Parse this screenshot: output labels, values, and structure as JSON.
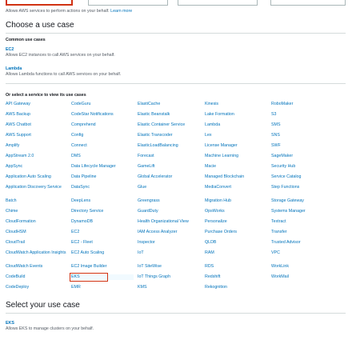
{
  "intro": {
    "text": "Allows AWS services to perform actions on your behalf.",
    "link": "Learn more"
  },
  "choose": {
    "title": "Choose a use case",
    "common_title": "Common use cases",
    "ec2": {
      "name": "EC2",
      "desc": "Allows EC2 instances to call AWS services on your behalf."
    },
    "lambda": {
      "name": "Lambda",
      "desc": "Allows Lambda functions to call AWS services on your behalf."
    },
    "select_title": "Or select a service to view its use cases"
  },
  "services": {
    "col1": [
      "API Gateway",
      "AWS Backup",
      "AWS Chatbot",
      "AWS Support",
      "Amplify",
      "AppStream 2.0",
      "AppSync",
      "Application Auto Scaling",
      "Application Discovery Service",
      "Batch",
      "Chime",
      "CloudFormation",
      "CloudHSM",
      "CloudTrail",
      "CloudWatch Application Insights",
      "CloudWatch Events",
      "CodeBuild",
      "CodeDeploy"
    ],
    "col2": [
      "CodeGuru",
      "CodeStar Notifications",
      "Comprehend",
      "Config",
      "Connect",
      "DMS",
      "Data Lifecycle Manager",
      "Data Pipeline",
      "DataSync",
      "DeepLens",
      "Directory Service",
      "DynamoDB",
      "EC2",
      "EC2 - Fleet",
      "EC2 Auto Scaling",
      "EC2 Image Builder",
      "EKS",
      "EMR"
    ],
    "col3": [
      "ElastiCache",
      "Elastic Beanstalk",
      "Elastic Container Service",
      "Elastic Transcoder",
      "ElasticLoadBalancing",
      "Forecast",
      "GameLift",
      "Global Accelerator",
      "Glue",
      "Greengrass",
      "GuardDuty",
      "Health Organizational View",
      "IAM Access Analyzer",
      "Inspector",
      "IoT",
      "IoT SiteWise",
      "IoT Things Graph",
      "KMS"
    ],
    "col4": [
      "Kinesis",
      "Lake Formation",
      "Lambda",
      "Lex",
      "License Manager",
      "Machine Learning",
      "Macie",
      "Managed Blockchain",
      "MediaConvert",
      "Migration Hub",
      "OpsWorks",
      "Personalize",
      "Purchase Orders",
      "QLDB",
      "RAM",
      "RDS",
      "Redshift",
      "Rekognition"
    ],
    "col5": [
      "RoboMaker",
      "S3",
      "SMS",
      "SNS",
      "SWF",
      "SageMaker",
      "Security Hub",
      "Service Catalog",
      "Step Functions",
      "Storage Gateway",
      "Systems Manager",
      "Textract",
      "Transfer",
      "Trusted Advisor",
      "VPC",
      "WorkLink",
      "WorkMail"
    ]
  },
  "select_use_case": {
    "title": "Select your use case",
    "eks_name": "EKS",
    "eks_desc": "Allows EKS to manage clusters on your behalf."
  }
}
